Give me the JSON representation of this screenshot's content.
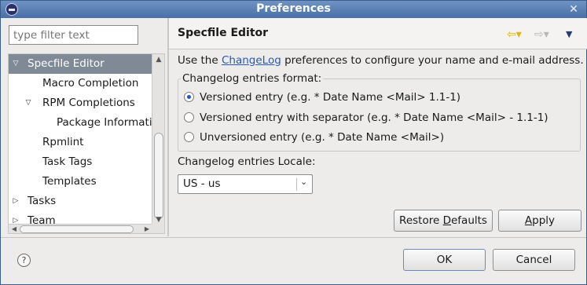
{
  "window": {
    "title": "Preferences",
    "close_glyph": "✕"
  },
  "filter": {
    "placeholder": "type filter text"
  },
  "tree": {
    "items": [
      {
        "label": "Specfile Editor",
        "selected": true,
        "expander": "▽"
      },
      {
        "label": "Macro Completion"
      },
      {
        "label": "RPM Completions",
        "expander": "▽"
      },
      {
        "label": "Package Informati"
      },
      {
        "label": "Rpmlint"
      },
      {
        "label": "Task Tags"
      },
      {
        "label": "Templates"
      },
      {
        "label": "Tasks",
        "expander": "▷"
      },
      {
        "label": "Team",
        "expander": "▷"
      }
    ]
  },
  "page": {
    "title": "Specfile Editor",
    "description_prefix": "Use the ",
    "description_link": "ChangeLog",
    "description_suffix": " preferences to configure your name and e-mail address.",
    "format_group_label": "Changelog entries format:",
    "format_options": [
      {
        "label": "Versioned entry (e.g. * Date Name <Mail> 1.1-1)",
        "checked": true
      },
      {
        "label": "Versioned entry with separator (e.g. * Date Name <Mail> - 1.1-1)",
        "checked": false
      },
      {
        "label": "Unversioned entry (e.g. * Date Name <Mail>)",
        "checked": false
      }
    ],
    "locale_label": "Changelog entries Locale:",
    "locale_value": "US - us",
    "restore_defaults_pre": "Restore ",
    "restore_defaults_mnemonic": "D",
    "restore_defaults_post": "efaults",
    "apply_mnemonic": "A",
    "apply_post": "pply"
  },
  "footer": {
    "ok": "OK",
    "cancel": "Cancel",
    "help_glyph": "?"
  },
  "icons": {
    "nav_back": "⇦▾",
    "nav_forward": "⇨▾",
    "view_menu": "▼",
    "combo_chevron": "⌄"
  },
  "colors": {
    "title_bar": "#4a6fa5",
    "selection": "#7f8a96",
    "link": "#2a57b6",
    "radio_dot": "#1e57c6"
  }
}
